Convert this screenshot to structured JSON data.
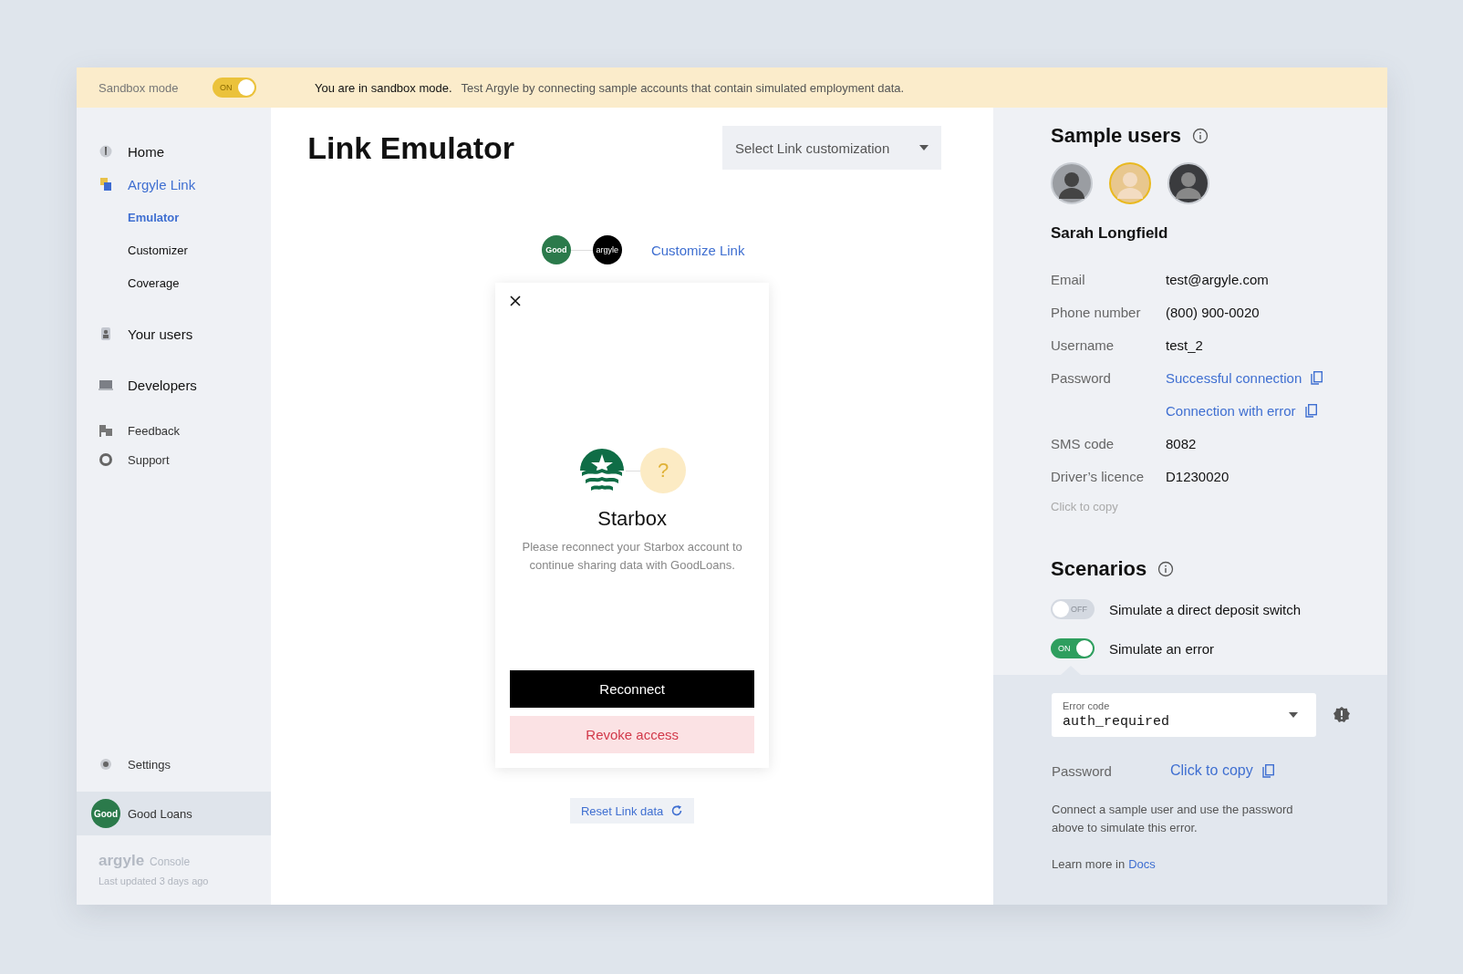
{
  "banner": {
    "label": "Sandbox mode",
    "toggle": {
      "text": "ON",
      "on": true
    },
    "message_bold": "You are in sandbox mode.",
    "message": "Test Argyle by connecting sample accounts that contain simulated employment data."
  },
  "sidebar": {
    "items": [
      {
        "label": "Home",
        "kind": "main",
        "selected": false
      },
      {
        "label": "Argyle Link",
        "kind": "main",
        "selected": true
      },
      {
        "label": "Emulator",
        "kind": "sub",
        "selected": true
      },
      {
        "label": "Customizer",
        "kind": "sub",
        "selected": false
      },
      {
        "label": "Coverage",
        "kind": "sub",
        "selected": false
      },
      {
        "label": "Your users",
        "kind": "main",
        "selected": false
      },
      {
        "label": "Developers",
        "kind": "main",
        "selected": false
      },
      {
        "label": "Feedback",
        "kind": "minor",
        "selected": false
      },
      {
        "label": "Support",
        "kind": "minor",
        "selected": false
      }
    ],
    "settings": "Settings",
    "account": {
      "badge": "Good",
      "name": "Good Loans"
    },
    "brand": "argyle",
    "brand_sub": "Console",
    "updated": "Last updated 3 days ago"
  },
  "main": {
    "title": "Link Emulator",
    "customization": {
      "placeholder": "Select Link customization"
    },
    "logos": [
      "Good",
      "argyle"
    ],
    "customize_link": "Customize Link",
    "modal": {
      "company": "Starbox",
      "unknown": "?",
      "message": "Please reconnect your Starbox account to continue sharing data with GoodLoans.",
      "primary": "Reconnect",
      "secondary": "Revoke access"
    },
    "reset": "Reset Link data"
  },
  "sample_users": {
    "title": "Sample users",
    "users": [
      {
        "selected": false
      },
      {
        "selected": true
      },
      {
        "selected": false
      }
    ],
    "name": "Sarah Longfield",
    "fields": [
      {
        "label": "Email",
        "kind": "text",
        "value": "test@argyle.com"
      },
      {
        "label": "Phone number",
        "kind": "text",
        "value": "(800) 900-0020"
      },
      {
        "label": "Username",
        "kind": "text",
        "value": "test_2"
      },
      {
        "label": "Password",
        "kind": "copy",
        "value": "Successful connection"
      },
      {
        "kind": "copy",
        "value": "Connection with error"
      },
      {
        "label": "SMS code",
        "kind": "text",
        "value": "8082"
      },
      {
        "label": "Driver’s licence",
        "kind": "text",
        "value": "D1230020"
      }
    ],
    "hint": "Click to copy"
  },
  "scenarios": {
    "title": "Scenarios",
    "items": [
      {
        "label": "Simulate a direct deposit switch",
        "toggle": "OFF",
        "on": false
      },
      {
        "label": "Simulate an error",
        "toggle": "ON",
        "on": true
      }
    ],
    "error_code": {
      "label": "Error code",
      "value": "auth_required"
    },
    "password_label": "Password",
    "password_value": "Click to copy",
    "description": "Connect a sample user and use the password above to simulate this error.",
    "learn_more": "Learn more in",
    "docs": "Docs"
  }
}
